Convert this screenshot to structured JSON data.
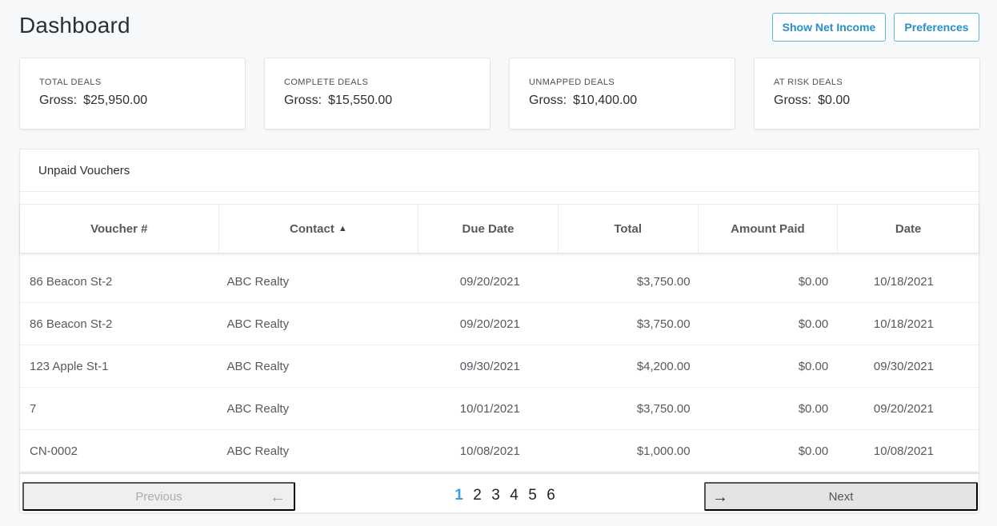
{
  "header": {
    "title": "Dashboard",
    "show_net_income_label": "Show Net Income",
    "preferences_label": "Preferences"
  },
  "stats": [
    {
      "label": "TOTAL DEALS",
      "gross_label": "Gross:",
      "value": "$25,950.00"
    },
    {
      "label": "COMPLETE DEALS",
      "gross_label": "Gross:",
      "value": "$15,550.00"
    },
    {
      "label": "UNMAPPED DEALS",
      "gross_label": "Gross:",
      "value": "$10,400.00"
    },
    {
      "label": "AT RISK DEALS",
      "gross_label": "Gross:",
      "value": "$0.00"
    }
  ],
  "vouchers": {
    "title": "Unpaid Vouchers",
    "columns": [
      "Voucher #",
      "Contact",
      "Due Date",
      "Total",
      "Amount Paid",
      "Date"
    ],
    "sort_icon": "triangle-up-icon",
    "rows": [
      [
        "86 Beacon St-2",
        "ABC Realty",
        "09/20/2021",
        "$3,750.00",
        "$0.00",
        "10/18/2021"
      ],
      [
        "86 Beacon St-2",
        "ABC Realty",
        "09/20/2021",
        "$3,750.00",
        "$0.00",
        "10/18/2021"
      ],
      [
        "123 Apple St-1",
        "ABC Realty",
        "09/30/2021",
        "$4,200.00",
        "$0.00",
        "09/30/2021"
      ],
      [
        "7",
        "ABC Realty",
        "10/01/2021",
        "$3,750.00",
        "$0.00",
        "09/20/2021"
      ],
      [
        "CN-0002",
        "ABC Realty",
        "10/08/2021",
        "$1,000.00",
        "$0.00",
        "10/08/2021"
      ]
    ]
  },
  "pagination": {
    "previous_label": "Previous",
    "next_label": "Next",
    "pages": [
      "1",
      "2",
      "3",
      "4",
      "5",
      "6"
    ],
    "current_page": "1"
  },
  "colors": {
    "accent": "#2a8fc4",
    "active_page": "#3a9fd6"
  }
}
